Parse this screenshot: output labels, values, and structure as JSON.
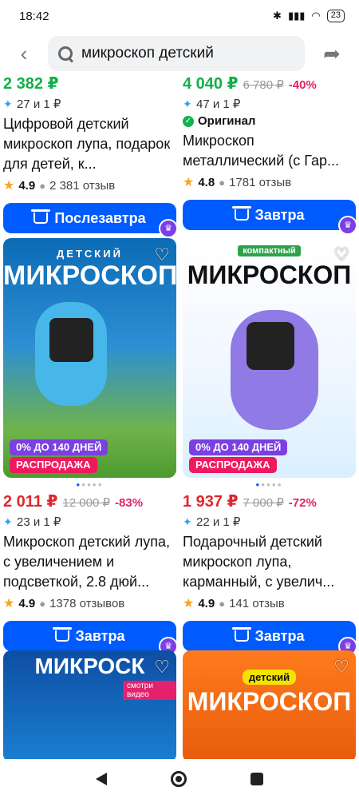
{
  "status": {
    "time": "18:42",
    "battery": "23"
  },
  "search": {
    "query": "микроскоп детский"
  },
  "cards": [
    {
      "price": "2 382 ₽",
      "bonus": "27 и 1 ₽",
      "title": "Цифровой детский микроскоп лупа, подарок для детей, к...",
      "rating": "4.9",
      "reviews": "2 381 отзыв",
      "delivery": "Послезавтра"
    },
    {
      "price": "4 040 ₽",
      "old_price": "6 780 ₽",
      "discount": "-40%",
      "bonus": "47 и 1 ₽",
      "original": "Оригинал",
      "title": "Микроскоп металлический (с Гар...",
      "rating": "4.8",
      "reviews": "1781 отзыв",
      "delivery": "Завтра"
    },
    {
      "price": "2 011 ₽",
      "old_price": "12 000 ₽",
      "discount": "-83%",
      "bonus": "23 и 1 ₽",
      "title": "Микроскоп детский лупа, с увеличением и подсветкой, 2.8 дюй...",
      "rating": "4.9",
      "reviews": "1378 отзывов",
      "delivery": "Завтра",
      "badge_installment": "0% ДО 140 ДНЕЙ",
      "badge_sale": "РАСПРОДАЖА",
      "art_title": "МИКРОСКОП",
      "art_sub": "ДЕТСКИЙ"
    },
    {
      "price": "1 937 ₽",
      "old_price": "7 000 ₽",
      "discount": "-72%",
      "bonus": "22 и 1 ₽",
      "title": "Подарочный детский микроскоп лупа, карманный, с увелич...",
      "rating": "4.9",
      "reviews": "141 отзыв",
      "delivery": "Завтра",
      "badge_installment": "0% ДО 140 ДНЕЙ",
      "badge_sale": "РАСПРОДАЖА",
      "art_title": "МИКРОСКОП",
      "art_sub": "компактный"
    },
    {
      "art_title": "МИКРОСК",
      "art_sub": "смотри видео"
    },
    {
      "art_title": "МИКРОСКОП",
      "art_sub": "детский"
    }
  ],
  "colors": {
    "accent": "#005bff",
    "green_price": "#10b04a",
    "red_price": "#e0262d",
    "discount": "#e4216d"
  }
}
